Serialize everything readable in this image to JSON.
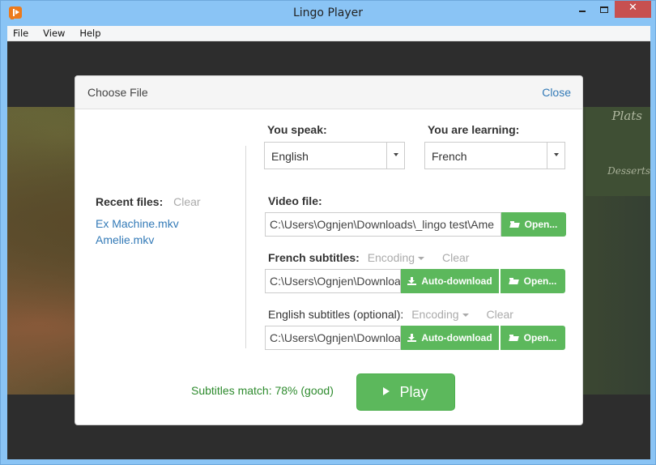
{
  "window": {
    "title": "Lingo Player",
    "icon": "lingo-player-app-icon",
    "controls": {
      "minimize": "minimize-icon",
      "maximize": "maximize-icon",
      "close": "✕"
    }
  },
  "menu": {
    "items": [
      "File",
      "View",
      "Help"
    ]
  },
  "video": {
    "chalkboard_text": [
      "Plats",
      "Desserts"
    ]
  },
  "dialog": {
    "title": "Choose File",
    "close_label": "Close",
    "recent": {
      "label": "Recent files:",
      "clear_label": "Clear",
      "files": [
        "Ex Machine.mkv",
        "Amelie.mkv"
      ]
    },
    "you_speak": {
      "label": "You speak:",
      "value": "English"
    },
    "you_learning": {
      "label": "You are learning:",
      "value": "French"
    },
    "video_file": {
      "label": "Video file:",
      "value": "C:\\Users\\Ognjen\\Downloads\\_lingo test\\Ame",
      "open_label": "Open..."
    },
    "french_subtitles": {
      "label": "French subtitles:",
      "encoding_label": "Encoding",
      "clear_label": "Clear",
      "value": "C:\\Users\\Ognjen\\Downloa",
      "auto_download_label": "Auto-download",
      "open_label": "Open..."
    },
    "english_subtitles": {
      "label": "English subtitles (optional):",
      "encoding_label": "Encoding",
      "clear_label": "Clear",
      "value": "C:\\Users\\Ognjen\\Downloa",
      "auto_download_label": "Auto-download",
      "open_label": "Open..."
    },
    "match_status": "Subtitles match: 78% (good)",
    "play_label": "Play"
  },
  "colors": {
    "accent_green": "#5cb85c",
    "link_blue": "#337ab7",
    "match_green": "#2e8b2e",
    "close_red": "#c75050",
    "titlebar_blue": "#8ac4f5"
  }
}
